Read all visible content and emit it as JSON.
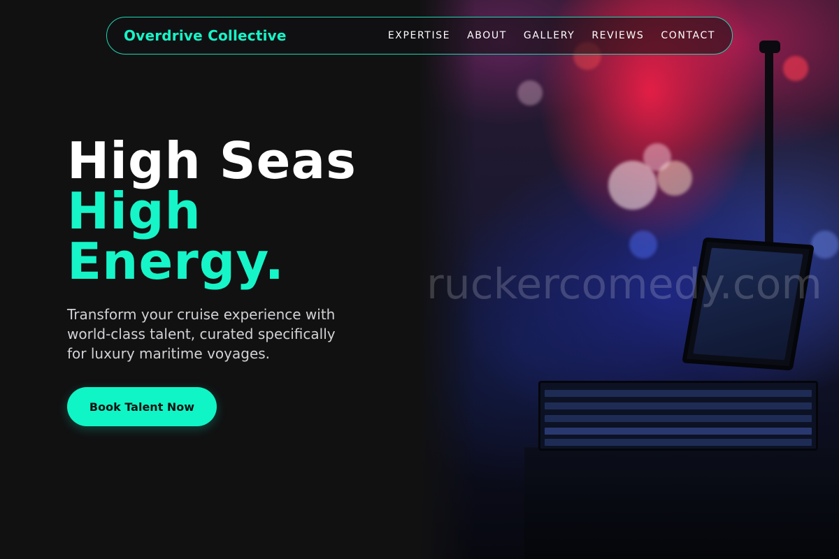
{
  "nav": {
    "brand": "Overdrive Collective",
    "links": [
      "EXPERTISE",
      "ABOUT",
      "GALLERY",
      "REVIEWS",
      "CONTACT"
    ]
  },
  "hero": {
    "title_line1": "High Seas",
    "title_line2": "High",
    "title_line3": "Energy.",
    "subtitle": "Transform your cruise experience with world-class talent, curated specifically for luxury maritime voyages.",
    "cta_label": "Book Talent Now"
  },
  "watermark": "ruckercomedy.com",
  "colors": {
    "accent": "#16f5c8",
    "background": "#111112",
    "text": "#ffffff",
    "muted_text": "#d2d2d6"
  }
}
